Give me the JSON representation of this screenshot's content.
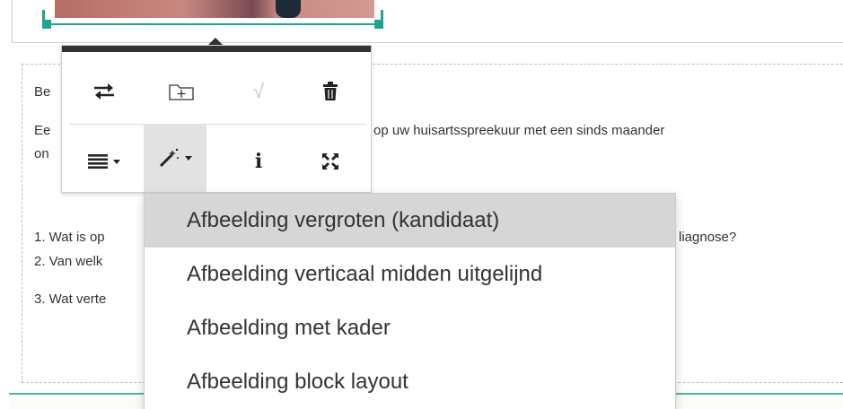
{
  "editor": {
    "line1": "Be",
    "line2a": "Ee",
    "line2b": "op uw huisartsspreekuur met een sinds maander",
    "line3": "on",
    "q1a": "1. Wat is op",
    "q1b": "liagnose?",
    "q2": "2. Van welk",
    "q3": "3. Wat verte"
  },
  "toolbar": {
    "buttons": [
      {
        "name": "swap",
        "icon": "swap-arrows-icon",
        "glyph": "⇄"
      },
      {
        "name": "folder",
        "icon": "folder-plus-icon",
        "glyph": "+"
      },
      {
        "name": "check",
        "icon": "check-icon",
        "glyph": "√"
      },
      {
        "name": "delete",
        "icon": "trash-icon"
      },
      {
        "name": "align",
        "icon": "align-justify-icon"
      },
      {
        "name": "style",
        "icon": "magic-wand-icon"
      },
      {
        "name": "info",
        "icon": "info-icon",
        "glyph": "i"
      },
      {
        "name": "expand",
        "icon": "expand-icon"
      }
    ]
  },
  "menu": {
    "items": [
      "Afbeelding vergroten (kandidaat)",
      "Afbeelding verticaal midden uitgelijnd",
      "Afbeelding met kader",
      "Afbeelding block layout"
    ],
    "hover_index": 0
  },
  "colors": {
    "accent": "#1fa58f",
    "toolbar_top": "#333333",
    "hover": "#d6d6d6"
  }
}
